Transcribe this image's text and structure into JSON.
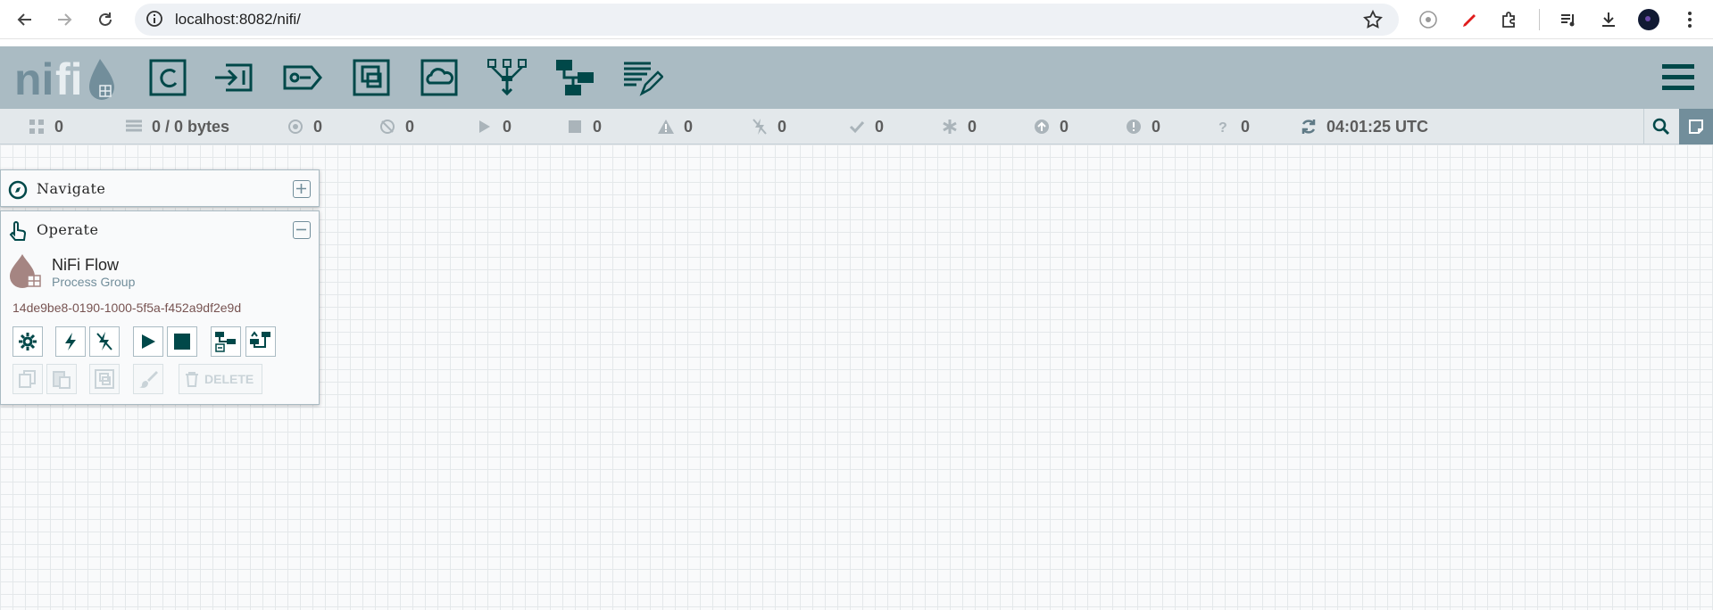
{
  "browser": {
    "url": "localhost:8082/nifi/"
  },
  "status": {
    "active_threads": "0",
    "queued": "0 / 0 bytes",
    "transmitting": "0",
    "not_transmitting": "0",
    "running": "0",
    "stopped": "0",
    "invalid": "0",
    "disabled": "0",
    "up_to_date": "0",
    "locally_modified": "0",
    "stale": "0",
    "locally_modified_stale": "0",
    "sync_failure": "0",
    "last_refreshed": "04:01:25 UTC"
  },
  "navigate": {
    "title": "Navigate"
  },
  "operate": {
    "title": "Operate",
    "component_name": "NiFi Flow",
    "component_type": "Process Group",
    "component_id": "14de9be8-0190-1000-5f5a-f452a9df2e9d",
    "delete_label": "DELETE"
  },
  "colors": {
    "header_bg": "#aabbc3",
    "statusbar_bg": "#e3e8eb",
    "icon_dark": "#004849",
    "accent": "#728e9b"
  }
}
